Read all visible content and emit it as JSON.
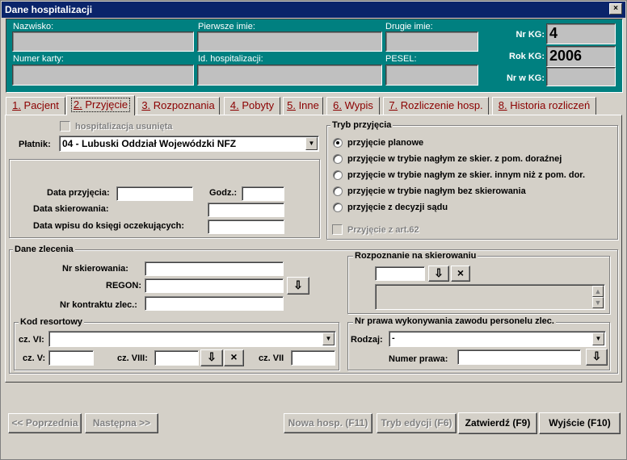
{
  "window": {
    "title": "Dane hospitalizacji",
    "close": "×"
  },
  "header": {
    "nazwisko": "Nazwisko:",
    "pierwsze_imie": "Pierwsze imie:",
    "drugie_imie": "Drugie imie:",
    "numer_karty": "Numer karty:",
    "id_hosp": "Id. hospitalizacji:",
    "pesel": "PESEL:",
    "nr_kg_label": "Nr KG:",
    "nr_kg_value": "4",
    "rok_kg_label": "Rok KG:",
    "rok_kg_value": "2006",
    "nr_w_kg_label": "Nr w KG:"
  },
  "tabs": [
    {
      "num": "1.",
      "label": " Pacjent"
    },
    {
      "num": "2.",
      "label": " Przyjęcie"
    },
    {
      "num": "3.",
      "label": " Rozpoznania"
    },
    {
      "num": "4.",
      "label": " Pobyty"
    },
    {
      "num": "5.",
      "label": " Inne"
    },
    {
      "num": "6.",
      "label": " Wypis"
    },
    {
      "num": "7.",
      "label": " Rozliczenie hosp."
    },
    {
      "num": "8.",
      "label": " Historia rozliczeń"
    }
  ],
  "przyjecie": {
    "usunieta": "hospitalizacja usunięta",
    "platnik_label": "Płatnik:",
    "platnik_value": "04 - Lubuski Oddział Wojewódzki NFZ",
    "data_przyjecia": "Data przyjęcia:",
    "godz": "Godz.:",
    "data_skierowania": "Data skierowania:",
    "data_wpisu": "Data wpisu do księgi oczekujących:"
  },
  "tryb": {
    "title": "Tryb przyjęcia",
    "options": [
      "przyjęcie planowe",
      "przyjęcie w trybie nagłym ze skier. z pom. doraźnej",
      "przyjęcie w trybie nagłym ze skier. innym niż z pom. dor.",
      "przyjęcie w trybie nagłym bez skierowania",
      "przyjęcie z decyzji sądu"
    ],
    "selected": 0,
    "art62": "Przyjęcie z art.62"
  },
  "zlecenie": {
    "title": "Dane zlecenia",
    "nr_skier": "Nr skierowania:",
    "regon": "REGON:",
    "nr_kontraktu": "Nr kontraktu zlec.:"
  },
  "rozpoznanie": {
    "title": "Rozpoznanie na skierowaniu",
    "clear": "×"
  },
  "kod": {
    "title": "Kod resortowy",
    "cz6": "cz. VI:",
    "cz5": "cz. V:",
    "cz8": "cz. VIII:",
    "cz7": "cz. VII",
    "clear": "×"
  },
  "prawo": {
    "title": "Nr prawa wykonywania zawodu personelu zlec.",
    "rodzaj": "Rodzaj:",
    "rodzaj_value": "-",
    "numer": "Numer prawa:"
  },
  "footer": {
    "prev": "<< Poprzednia",
    "next": "Następna >>",
    "nowa": "Nowa hosp. (F11)",
    "tryb": "Tryb edycji (F6)",
    "zatwierdz": "Zatwierdź (F9)",
    "wyjscie": "Wyjście (F10)"
  }
}
